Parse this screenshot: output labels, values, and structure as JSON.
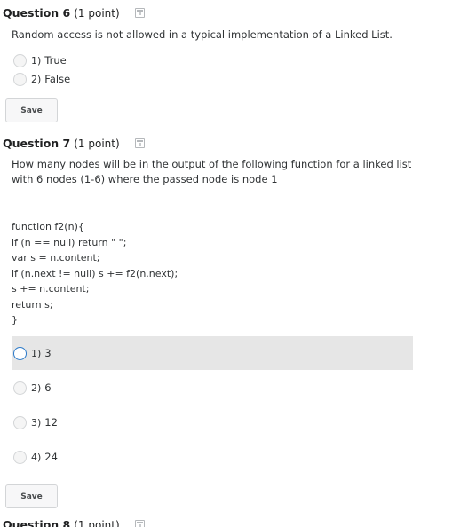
{
  "questions": [
    {
      "title": "Question 6",
      "points": "(1 point)",
      "text": "Random access is not allowed in a typical implementation of a Linked List.",
      "options": [
        {
          "num": "1)",
          "label": "True"
        },
        {
          "num": "2)",
          "label": "False"
        }
      ],
      "save_label": "Save"
    },
    {
      "title": "Question 7",
      "points": "(1 point)",
      "text": "How many nodes will be in the output of the following function for a linked list with 6 nodes (1-6) where the passed node is node 1",
      "code": [
        "function f2(n){",
        "if (n == null) return \" \";",
        "var s = n.content;",
        "if (n.next != null) s += f2(n.next);",
        "s += n.content;",
        "return s;",
        "}"
      ],
      "options": [
        {
          "num": "1)",
          "label": "3"
        },
        {
          "num": "2)",
          "label": "6"
        },
        {
          "num": "3)",
          "label": "12"
        },
        {
          "num": "4)",
          "label": "24"
        }
      ],
      "selected_option": "1) 3",
      "save_label": "Save"
    },
    {
      "title": "Question 8",
      "points": "(1 point)"
    }
  ]
}
